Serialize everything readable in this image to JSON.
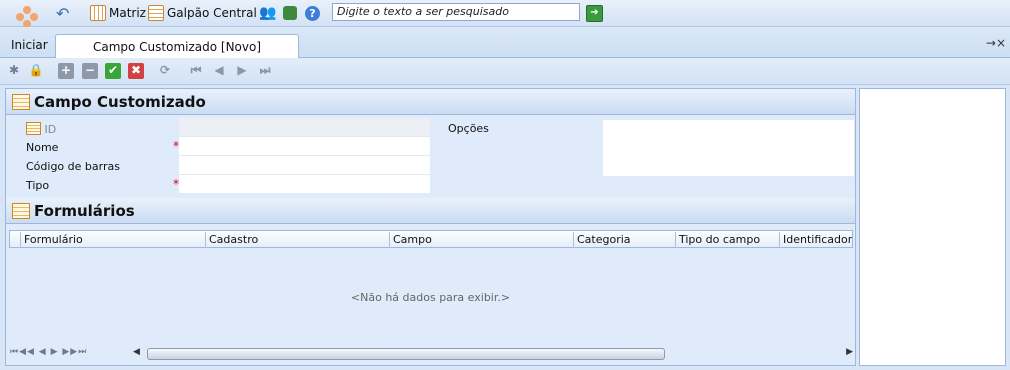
{
  "top_toolbar": {
    "matrix_label": "Matriz",
    "warehouse_label": "Galpão Central",
    "search_placeholder": "Digite o texto a ser pesquisado"
  },
  "tabs": {
    "home_label": "Iniciar",
    "active_label": "Campo Customizado [Novo]",
    "close_label": "→×"
  },
  "section_custom_field": {
    "title": "Campo Customizado",
    "fields": {
      "id": "ID",
      "name": "Nome",
      "barcode": "Código de barras",
      "type": "Tipo",
      "options": "Opções"
    },
    "required_mark": "*"
  },
  "section_forms": {
    "title": "Formulários",
    "columns": [
      "Formulário",
      "Cadastro",
      "Campo",
      "Categoria",
      "Tipo do campo",
      "Identificador de"
    ],
    "empty_message": "<Não há dados para exibir.>"
  },
  "pager": "⏮◀◀ ◀ ▶ ▶▶⏭",
  "colors": {
    "background": "#d7e5f6",
    "accent": "#ffffff",
    "required": "#dd0000"
  }
}
